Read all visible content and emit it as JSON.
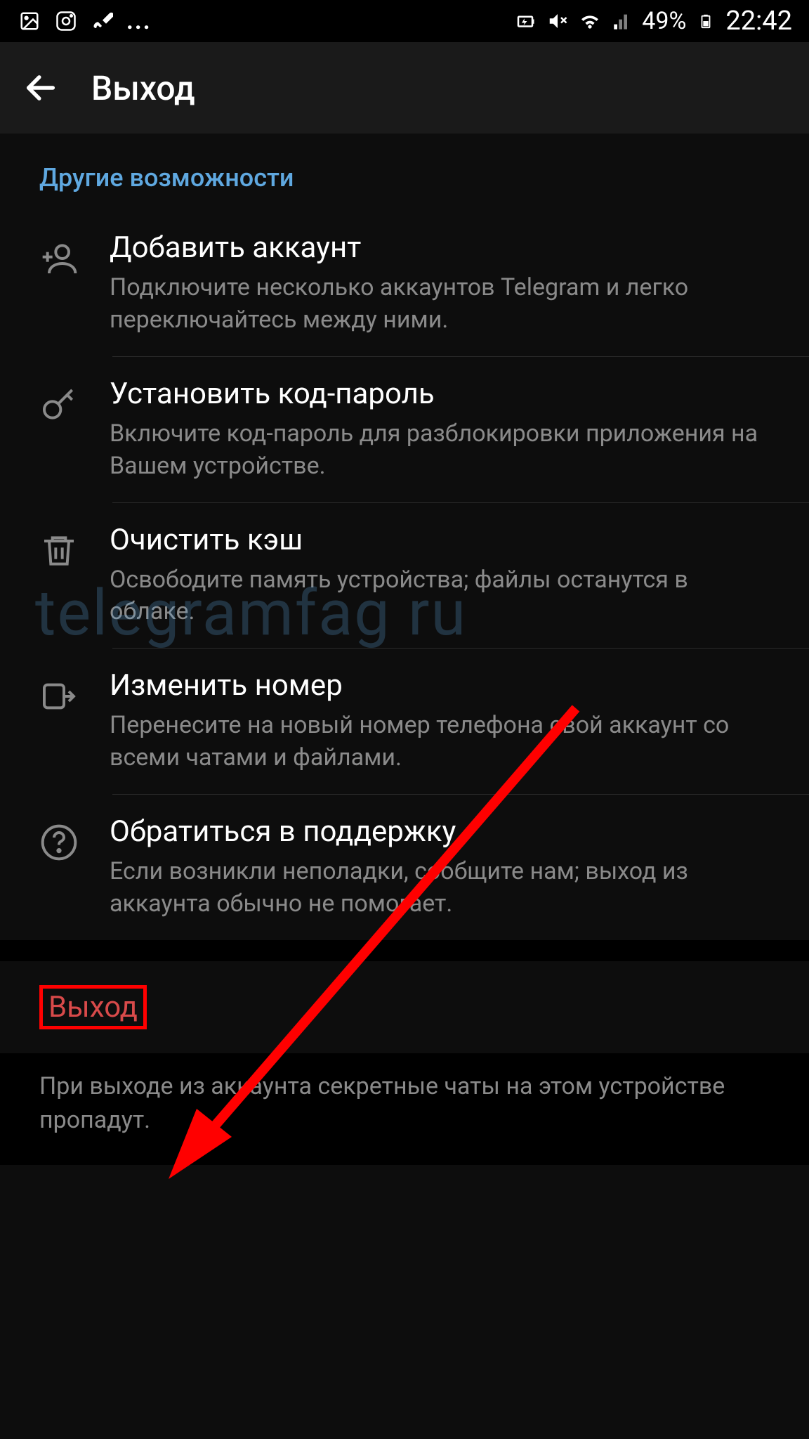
{
  "status_bar": {
    "battery_pct": "49%",
    "time": "22:42"
  },
  "header": {
    "title": "Выход"
  },
  "section_header": "Другие возможности",
  "items": [
    {
      "title": "Добавить аккаунт",
      "desc": "Подключите несколько аккаунтов Telegram и легко переключайтесь между ними."
    },
    {
      "title": "Установить код-пароль",
      "desc": "Включите код-пароль для разблокировки приложения на Вашем устройстве."
    },
    {
      "title": "Очистить кэш",
      "desc": "Освободите память устройства; файлы останутся в облаке."
    },
    {
      "title": "Изменить номер",
      "desc": "Перенесите на новый номер телефона свой аккаунт со всеми чатами и файлами."
    },
    {
      "title": "Обратиться в поддержку",
      "desc": "Если возникли неполадки, сообщите нам; выход из аккаунта обычно не помогает."
    }
  ],
  "logout_label": "Выход",
  "footer_note": "При выходе из аккаунта секретные чаты на этом устройстве пропадут.",
  "watermark": "telegramfag ru"
}
